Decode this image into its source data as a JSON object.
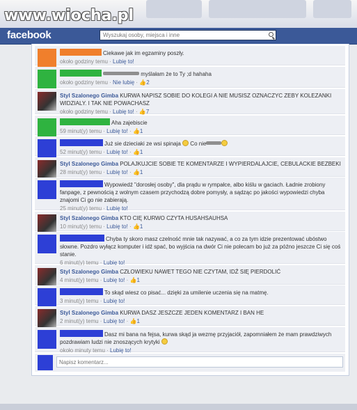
{
  "watermark": "www.wiocha.pl",
  "header": {
    "logo": "facebook",
    "search_placeholder": "Wyszukaj osoby, miejsca i inne"
  },
  "meta_like": "Lubię to!",
  "meta_unlike": "Nie lubię",
  "comments": [
    {
      "name": "",
      "text": "Ciekawe jak im egzaminy poszły.",
      "time": "około godziny temu",
      "likes": "",
      "avatar": "#f07f2c",
      "redact": "#f07f2c",
      "rw": 60
    },
    {
      "name": "",
      "text": "myślałam że to Ty ;d hahaha",
      "time": "około godziny temu",
      "likes": "2",
      "unlike": true,
      "avatar": "#2fb340",
      "redact": "#2fb340",
      "rw": 60
    },
    {
      "name": "Styl Szalonego Gimba",
      "text": "KURWA NAPISZ SOBIE DO KOLEGI A NIE MUSISZ OZNACZYC ZEBY KOLEZANKI WIDZIALY. I TAK NIE POWACHASZ",
      "time": "około godziny temu",
      "likes": "7",
      "avatar": "gimba"
    },
    {
      "name": "",
      "text": "Aha zajebiscie",
      "time": "59 minut(y) temu",
      "likes": "1",
      "avatar": "#2fb340",
      "redact": "#2fb340",
      "rw": 72
    },
    {
      "name": "",
      "text": "Już sie dzieciaki ze wsi spinaja",
      "text2": "Co nie",
      "time": "52 minut(y) temu",
      "likes": "1",
      "avatar": "#2d3fd6",
      "redact": "#2d3fd6",
      "rw": 62
    },
    {
      "name": "Styl Szalonego Gimba",
      "text": "POLAJKUJCIE SOBIE TE KOMENTARZE I WYPIERDALAJCIE, CEBULACKIE BEZBEKI",
      "time": "28 minut(y) temu",
      "likes": "1",
      "avatar": "gimba"
    },
    {
      "name": "",
      "text": "Wypowiedź \"dorosłej osoby\", dla prądu w rympałce, albo kiślu w gaciach. Ładnie zrobiony fanpage, z pewnością z wolnym czasem przychodzą dobre pomysły, a sądząc po jakości wypowiedzi chyba znajomi Ci go nie zabierają.",
      "time": "25 minut(y) temu",
      "likes": "",
      "avatar": "#2d3fd6",
      "redact": "#2d3fd6",
      "rw": 62
    },
    {
      "name": "Styl Szalonego Gimba",
      "text": "KTO CIĘ KURWO CZYTA HUSAHSAUHSA",
      "time": "10 minut(y) temu",
      "likes": "1",
      "avatar": "gimba"
    },
    {
      "name": "",
      "text": "Chyba ty skoro masz czelność mnie tak nazywać, a co za tym idzie prezentować ubóstwo słowne. Pozdro wyłącz komputer i idź spać, bo wyjścia na dwór Ci nie polecam bo już za późno jeszcze Ci się coś stanie.",
      "time": "6 minut(y) temu",
      "likes": "",
      "avatar": "#2d3fd6",
      "redact": "#2d3fd6",
      "rw": 64
    },
    {
      "name": "Styl Szalonego Gimba",
      "text": "CZŁOWIEKU NAWET TEGO NIE CZYTAM, IDŹ SIĘ PIERDOLIĆ",
      "time": "4 minut(y) temu",
      "likes": "1",
      "avatar": "gimba"
    },
    {
      "name": "",
      "text": "To skąd wiesz co pisać... dzięki za umilenie uczenia się na matmę.",
      "time": "3 minut(y) temu",
      "likes": "",
      "avatar": "#2d3fd6",
      "redact": "#2d3fd6",
      "rw": 62
    },
    {
      "name": "Styl Szalonego Gimba",
      "text": "KURWA DASZ JESZCZE JEDEN KOMENTARZ I BAN HE",
      "time": "2 minut(y) temu",
      "likes": "1",
      "avatar": "gimba"
    },
    {
      "name": "",
      "text": "Dasz mi bana na fejsa, kurwa skąd ja wezmę przyjaciół, zapomniałem że mam prawdziwych pozdrawiam ludzi nie znoszących krytyki",
      "time": "około minuty temu",
      "likes": "",
      "avatar": "#2d3fd6",
      "redact": "#2d3fd6",
      "rw": 62,
      "emo": true
    }
  ],
  "new_comment_placeholder": "Napisz komentarz..."
}
